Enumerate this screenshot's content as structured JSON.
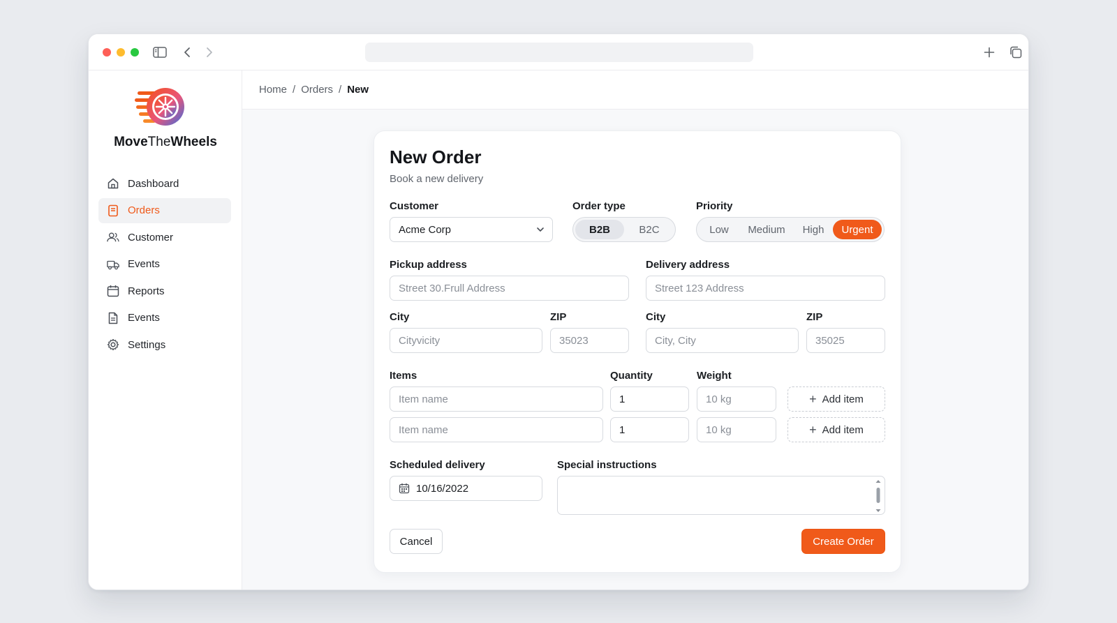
{
  "app": {
    "brand_bold": "Move",
    "brand_mid": "The",
    "brand_end": "Wheels",
    "accent": "#f05a1a"
  },
  "titlebar": {
    "icons": [
      "sidebar-toggle-icon",
      "back-icon",
      "forward-icon",
      "new-tab-icon",
      "tabs-overview-icon"
    ]
  },
  "sidebar": {
    "items": [
      {
        "label": "Dashboard",
        "icon": "home-icon",
        "active": false
      },
      {
        "label": "Orders",
        "icon": "document-icon",
        "active": true
      },
      {
        "label": "Customer",
        "icon": "users-icon",
        "active": false
      },
      {
        "label": "Events",
        "icon": "truck-icon",
        "active": false
      },
      {
        "label": "Reports",
        "icon": "calendar-icon",
        "active": false
      },
      {
        "label": "Events",
        "icon": "file-icon",
        "active": false
      },
      {
        "label": "Settings",
        "icon": "gear-icon",
        "active": false
      }
    ]
  },
  "breadcrumb": {
    "home": "Home",
    "orders": "Orders",
    "current": "New",
    "separator": "/"
  },
  "form": {
    "title": "New Order",
    "subtitle": "Book a new delivery",
    "customer": {
      "label": "Customer",
      "value": "Acme Corp"
    },
    "order_type": {
      "label": "Order type",
      "options": [
        "B2B",
        "B2C"
      ],
      "selected": "B2B"
    },
    "priority": {
      "label": "Priority",
      "options": [
        "Low",
        "Medium",
        "High",
        "Urgent"
      ],
      "selected": "Urgent"
    },
    "pickup": {
      "label": "Pickup address",
      "placeholder": "Street 30.Frull Address"
    },
    "delivery": {
      "label": "Delivery address",
      "placeholder": "Street 123 Address"
    },
    "pickup_city": {
      "label": "City",
      "placeholder": "Cityvicity"
    },
    "pickup_zip": {
      "label": "ZIP",
      "placeholder": "35023"
    },
    "delivery_city": {
      "label": "City",
      "placeholder": "City, City"
    },
    "delivery_zip": {
      "label": "ZIP",
      "placeholder": "35025"
    },
    "items": {
      "label": "Items",
      "quantity_label": "Quantity",
      "weight_label": "Weight",
      "rows": [
        {
          "name_placeholder": "Item name",
          "quantity": "1",
          "weight_placeholder": "10 kg",
          "add_label": "Add item"
        },
        {
          "name_placeholder": "Item name",
          "quantity": "1",
          "weight_placeholder": "10 kg",
          "add_label": "Add item"
        }
      ]
    },
    "scheduled": {
      "label": "Scheduled delivery",
      "value": "10/16/2022"
    },
    "instructions": {
      "label": "Special instructions",
      "value": ""
    },
    "cancel_label": "Cancel",
    "submit_label": "Create Order"
  }
}
